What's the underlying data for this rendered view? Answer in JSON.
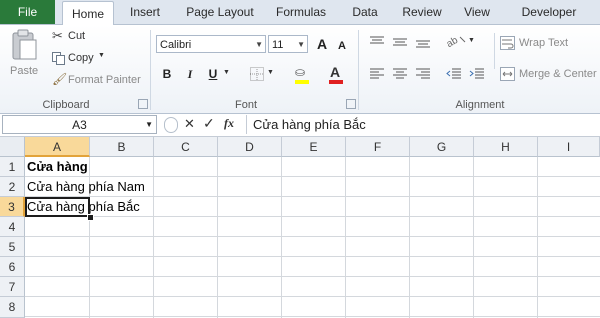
{
  "tabs": {
    "file": "File",
    "home": "Home",
    "insert": "Insert",
    "page_layout": "Page Layout",
    "formulas": "Formulas",
    "data": "Data",
    "review": "Review",
    "view": "View",
    "developer": "Developer"
  },
  "clipboard": {
    "paste": "Paste",
    "cut": "Cut",
    "copy": "Copy",
    "format_painter": "Format Painter",
    "group_label": "Clipboard"
  },
  "font": {
    "name": "Calibri",
    "size": "11",
    "group_label": "Font",
    "bold": "B",
    "italic": "I",
    "underline": "U",
    "grow": "A",
    "shrink": "A",
    "font_color": "A",
    "font_color_hex": "#e02020",
    "fill_color_hex": "#ffff00"
  },
  "alignment": {
    "wrap_text": "Wrap Text",
    "merge_center": "Merge & Center",
    "group_label": "Alignment"
  },
  "formula_bar": {
    "name_box": "A3",
    "cancel": "✕",
    "enter": "✓",
    "fx": "fx",
    "formula": "Cửa hàng phía Bắc"
  },
  "sheet": {
    "columns": [
      "A",
      "B",
      "C",
      "D",
      "E",
      "F",
      "G",
      "H",
      "I"
    ],
    "rows": [
      "1",
      "2",
      "3",
      "4",
      "5",
      "6",
      "7",
      "8"
    ],
    "selected_column": "A",
    "selected_row": "3",
    "cells": {
      "A1": "Cửa hàng",
      "A2": "Cửa hàng phía Nam",
      "A3": "Cửa hàng phía Bắc"
    }
  },
  "accent_color": "#2a7a3a"
}
